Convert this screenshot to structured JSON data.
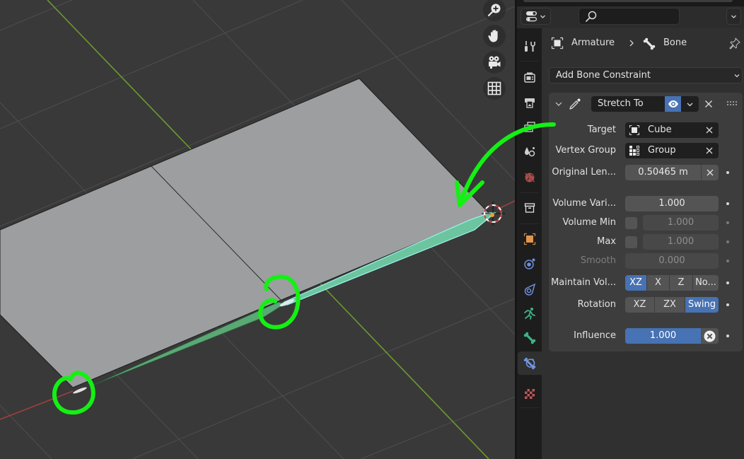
{
  "viewport": {
    "navigation_gizmo": [
      {
        "icon": "zoom-in-icon"
      },
      {
        "icon": "hand-icon"
      },
      {
        "icon": "camera-icon"
      },
      {
        "icon": "grid-icon"
      }
    ],
    "colors": {
      "background": "#393939",
      "grid": "#4e4e4e",
      "plane": "#9d9ea0",
      "x_axis": "#9e3f3f",
      "y_axis": "#6c9a30",
      "bone": "#5aa874",
      "bone_selected": "#6cc59e",
      "bone_outline_selected": "#9af3ee",
      "annotation": "#14f014"
    }
  },
  "properties": {
    "header": {
      "editor_type_icon": "properties-icon",
      "search_icon": "search-icon",
      "search_value": "",
      "search_placeholder": ""
    },
    "tabs": [
      {
        "id": "tool",
        "icon": "tool-icon",
        "active": false
      },
      {
        "id": "render",
        "icon": "render-icon",
        "active": false
      },
      {
        "id": "output",
        "icon": "output-icon",
        "active": false
      },
      {
        "id": "view_layer",
        "icon": "view-layer-icon",
        "active": false
      },
      {
        "id": "scene",
        "icon": "scene-icon",
        "active": false
      },
      {
        "id": "world",
        "icon": "world-icon",
        "active": false
      },
      {
        "id": "collection",
        "icon": "collection-icon",
        "active": false
      },
      {
        "id": "object",
        "icon": "object-icon",
        "active": false
      },
      {
        "id": "physics",
        "icon": "physics-icon",
        "active": false
      },
      {
        "id": "object_constraints",
        "icon": "object-constraint-icon",
        "active": false
      },
      {
        "id": "object_data",
        "icon": "armature-data-icon",
        "active": false
      },
      {
        "id": "bone",
        "icon": "bone-icon",
        "active": false
      },
      {
        "id": "bone_constraints",
        "icon": "bone-constraint-icon",
        "active": true
      },
      {
        "id": "texture",
        "icon": "texture-icon",
        "active": false
      }
    ],
    "breadcrumb": {
      "object": "Armature",
      "bone": "Bone"
    },
    "add_constraint_label": "Add Bone Constraint",
    "accent_color": "#4772b3",
    "constraint": {
      "name": "Stretch To",
      "visible": true,
      "target": {
        "label": "Target",
        "value": "Cube"
      },
      "vertex_group": {
        "label": "Vertex Group",
        "value": "Group"
      },
      "original_length": {
        "label": "Original Len...",
        "value": "0.50465 m"
      },
      "volume_variation": {
        "label": "Volume Vari...",
        "value": "1.000"
      },
      "volume_min": {
        "label": "Volume Min",
        "checked": false,
        "value": "1.000"
      },
      "volume_max": {
        "label": "Max",
        "checked": false,
        "value": "1.000"
      },
      "smooth": {
        "label": "Smooth",
        "value": "0.000",
        "disabled": true
      },
      "maintain_volume": {
        "label": "Maintain Vol...",
        "options": [
          "XZ",
          "X",
          "Z",
          "No..."
        ],
        "selected": "XZ"
      },
      "rotation": {
        "label": "Rotation",
        "options": [
          "XZ",
          "ZX",
          "Swing"
        ],
        "selected": "Swing"
      },
      "influence": {
        "label": "Influence",
        "value": "1.000",
        "fraction": 1.0
      }
    }
  }
}
